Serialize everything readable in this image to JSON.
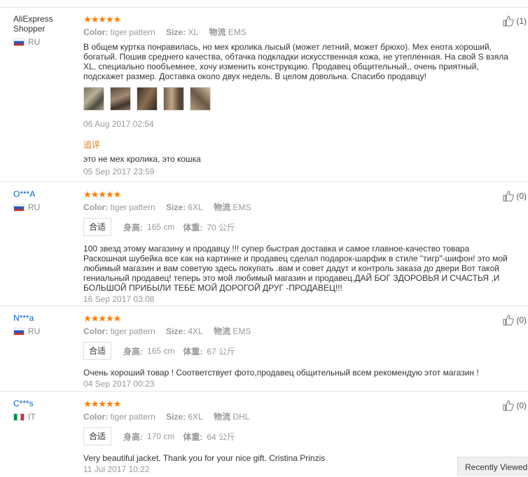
{
  "labels": {
    "color": "Color:",
    "size": "Size:",
    "shipping": "物流",
    "fit": "合适",
    "height": "身高:",
    "weight": "体重:",
    "reply": "追评"
  },
  "reviews": [
    {
      "user": "AliExpress Shopper",
      "country": "RU",
      "stars": "★★★★★",
      "color": "tiger pattern",
      "size": "XL",
      "shipping": "EMS",
      "text": "В общем куртка понравилась, но мех кролика лысый (может летний, может брюхо). Мех енота хороший, богатый. Пошив среднего качества, обтачка подкладки искусственная кожа, не утепленная. На свой S взяла XL, специально пообъемнее, хочу изменить конструкцию. Продавец общительный,, очень приятный, подскажет размер. Доставка около двух недель. В целом довольна. Спасибо продавцу!",
      "date": "06 Aug 2017 02:54",
      "reply_text": "это не мех кролика, это кошка",
      "reply_date": "05 Sep 2017 23:59",
      "likes": "(1)",
      "image_icons": [
        "photo-1",
        "photo-2",
        "photo-3",
        "photo-4",
        "photo-5"
      ]
    },
    {
      "user": "O***A",
      "country": "RU",
      "stars": "★★★★★",
      "color": "tiger pattern",
      "size": "6XL",
      "shipping": "EMS",
      "height": "165 cm",
      "weight": "70 公斤",
      "text": "100 звезд этому магазину и продавцу !!! супер быстрая доставка и самое главное-качество товара Раскошная шубейка все как на картинке и продавец сделал подарок-шарфик в стиле \"тигр\"-шифон! это мой любимый магазин и вам советую здесь покупать .вам и совет дадут и контроль заказа до двери Вот такой гениальный продавец! теперь это мой любимый магазин и продавец.ДАЙ БОГ ЗДОРОВЬЯ И СЧАСТЬЯ ,И БОЛЬШОЙ ПРИБЫЛИ ТЕБЕ МОЙ ДОРОГОЙ ДРУГ -ПРОДАВЕЦ!!!",
      "date": "16 Sep 2017 03:08",
      "likes": "(0)"
    },
    {
      "user": "N***a",
      "country": "RU",
      "stars": "★★★★★",
      "color": "tiger pattern",
      "size": "4XL",
      "shipping": "EMS",
      "height": "165 cm",
      "weight": "67 公斤",
      "text": "Очень хороший товар ! Соответствует фото,продавец общительный всем рекомендую этот магазин !",
      "date": "04 Sep 2017 00:23",
      "likes": "(0)"
    },
    {
      "user": "C***s",
      "country": "IT",
      "stars": "★★★★★",
      "color": "tiger pattern",
      "size": "6XL",
      "shipping": "DHL",
      "height": "170 cm",
      "weight": "64 公斤",
      "text": "Very beautiful jacket. Thank you for your nice gift. Cristina Prinzis",
      "date": "11 Jul 2017 10:22",
      "likes": "(0)"
    }
  ],
  "recently_viewed": "Recently Viewed",
  "colors": {
    "star": "#ff7d00",
    "reply_label": "#e8790b",
    "username_link": "#0a63c6"
  }
}
